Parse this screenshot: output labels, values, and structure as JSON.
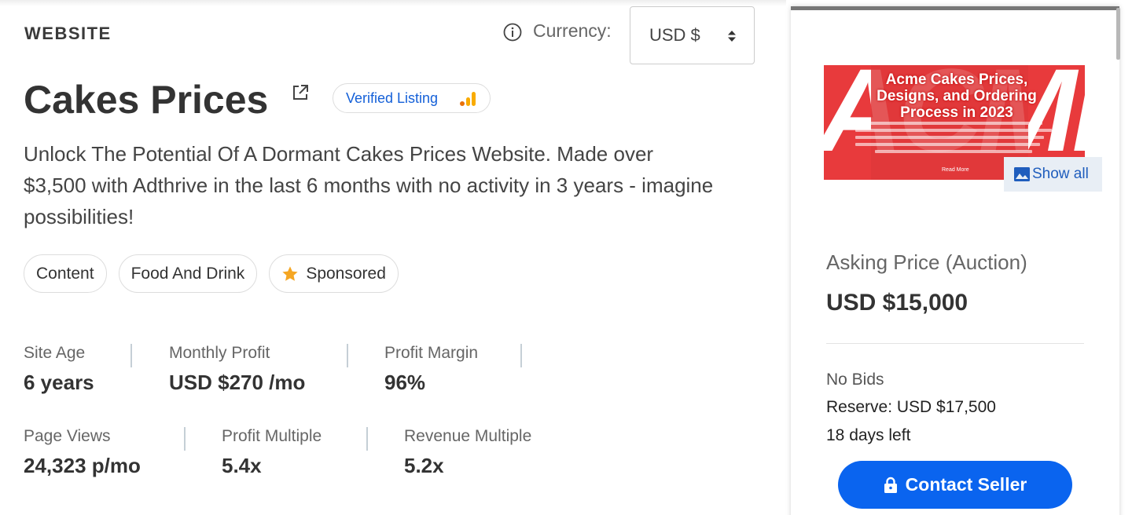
{
  "listing": {
    "category": "WEBSITE",
    "title": "Cakes Prices",
    "verified_badge": "Verified Listing",
    "description": "Unlock The Potential Of A Dormant Cakes Prices Website. Made over $3,500 with Adthrive in the last 6 months with no activity in 3 years - imagine possibilities!",
    "tags": [
      {
        "label": "Content",
        "icon": null
      },
      {
        "label": "Food And Drink",
        "icon": null
      },
      {
        "label": "Sponsored",
        "icon": "star-icon"
      }
    ]
  },
  "currency": {
    "label": "Currency:",
    "selected": "USD $",
    "info_icon": "info-icon"
  },
  "stats": [
    {
      "label": "Site Age",
      "value": "6 years"
    },
    {
      "label": "Monthly Profit",
      "value": "USD $270 /mo"
    },
    {
      "label": "Profit Margin",
      "value": "96%"
    },
    {
      "label": "Page Views",
      "value": "24,323 p/mo"
    },
    {
      "label": "Profit Multiple",
      "value": "5.4x"
    },
    {
      "label": "Revenue Multiple",
      "value": "5.2x"
    }
  ],
  "sidebar": {
    "thumbnail_title": "Acme Cakes Prices, Designs, and Ordering Process in 2023",
    "thumbnail_brand": "ACME",
    "thumbnail_more": "Read More",
    "show_all": "Show all",
    "asking_label": "Asking Price (Auction)",
    "asking_value": "USD $15,000",
    "bids": "No Bids",
    "reserve": "Reserve: USD $17,500",
    "days_left": "18 days left",
    "contact_button": "Contact Seller"
  },
  "colors": {
    "primary_button": "#0a64ef",
    "verified_text": "#1460d8",
    "star": "#f5a623",
    "thumbnail_bg": "#e83a3c"
  }
}
